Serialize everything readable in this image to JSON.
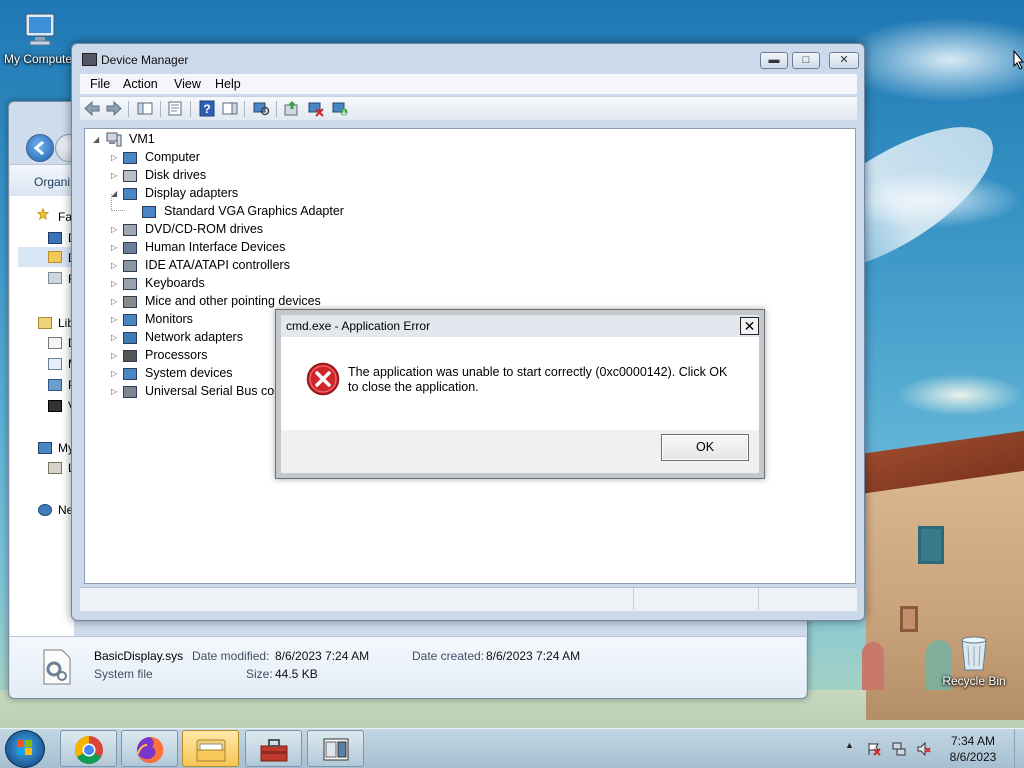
{
  "desktop": {
    "icons": [
      {
        "label": "My Computer"
      },
      {
        "label": "Recycle Bin"
      }
    ]
  },
  "explorer": {
    "toolbar_label": "Organi",
    "sidebar": [
      {
        "label": "Fav",
        "icon": "star-icon"
      },
      {
        "label": "D",
        "icon": "desktop-icon"
      },
      {
        "label": "D",
        "icon": "downloads-icon"
      },
      {
        "label": "R",
        "icon": "recent-places-icon"
      },
      {
        "label": "Lib",
        "icon": "libraries-icon"
      },
      {
        "label": "D",
        "icon": "documents-icon"
      },
      {
        "label": "M",
        "icon": "music-icon"
      },
      {
        "label": "P",
        "icon": "pictures-icon"
      },
      {
        "label": "V",
        "icon": "videos-icon"
      },
      {
        "label": "My",
        "icon": "computer-icon"
      },
      {
        "label": "L",
        "icon": "local-disk-icon"
      },
      {
        "label": "Ne",
        "icon": "network-icon"
      }
    ],
    "details": {
      "file_name": "BasicDisplay.sys",
      "file_type": "System file",
      "date_modified_label": "Date modified:",
      "date_modified": "8/6/2023 7:24 AM",
      "size_label": "Size:",
      "size": "44.5 KB",
      "date_created_label": "Date created:",
      "date_created": "8/6/2023 7:24 AM"
    }
  },
  "device_manager": {
    "title": "Device Manager",
    "menu": [
      "File",
      "Action",
      "View",
      "Help"
    ],
    "tree": {
      "root": "VM1",
      "items": [
        {
          "label": "Computer",
          "expanded": false
        },
        {
          "label": "Disk drives",
          "expanded": false
        },
        {
          "label": "Display adapters",
          "expanded": true
        },
        {
          "label": "Standard VGA Graphics Adapter",
          "child": true
        },
        {
          "label": "DVD/CD-ROM drives",
          "expanded": false
        },
        {
          "label": "Human Interface Devices",
          "expanded": false
        },
        {
          "label": "IDE ATA/ATAPI controllers",
          "expanded": false
        },
        {
          "label": "Keyboards",
          "expanded": false
        },
        {
          "label": "Mice and other pointing devices",
          "expanded": false
        },
        {
          "label": "Monitors",
          "expanded": false
        },
        {
          "label": "Network adapters",
          "expanded": false
        },
        {
          "label": "Processors",
          "expanded": false
        },
        {
          "label": "System devices",
          "expanded": false
        },
        {
          "label": "Universal Serial Bus cont",
          "expanded": false
        }
      ]
    }
  },
  "error_dialog": {
    "title": "cmd.exe - Application Error",
    "message": "The application was unable to start correctly (0xc0000142). Click OK to close the application.",
    "ok_label": "OK",
    "close_glyph": "✕"
  },
  "taskbar": {
    "apps": [
      "chrome",
      "firefox",
      "file-explorer",
      "toolbox",
      "device-manager"
    ],
    "clock_time": "7:34 AM",
    "clock_date": "8/6/2023"
  },
  "colors": {
    "error_red": "#d0262b",
    "window_frame": "#cbd9ea"
  }
}
